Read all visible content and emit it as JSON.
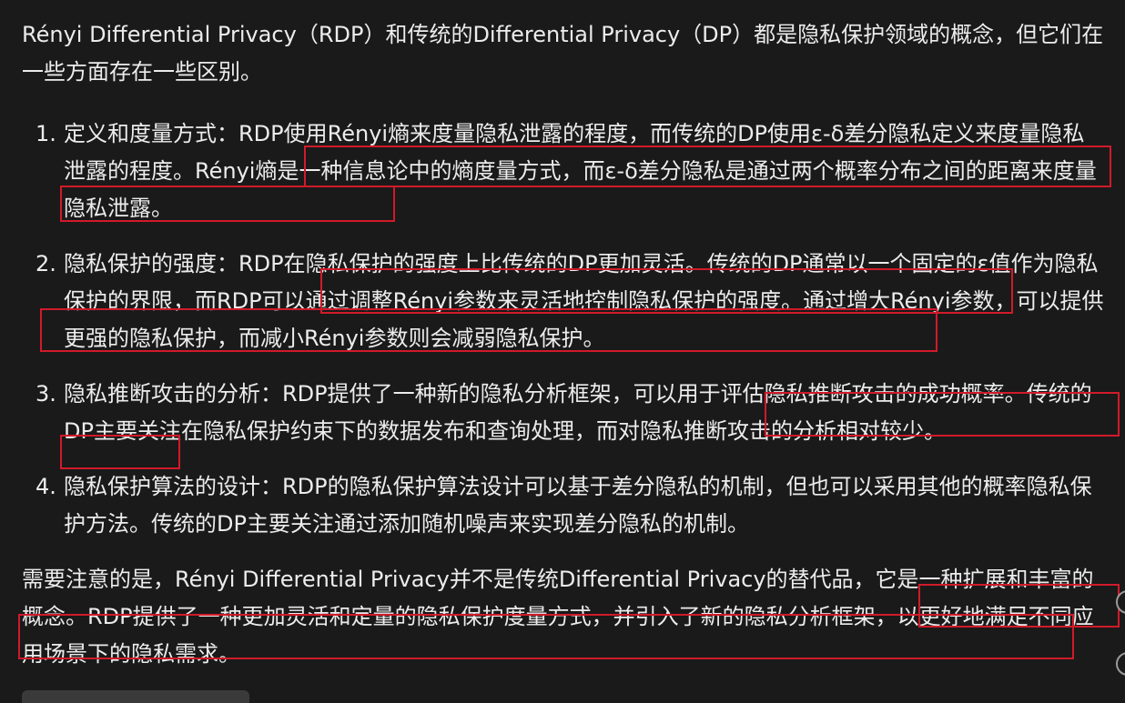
{
  "intro": "Rényi Differential Privacy（RDP）和传统的Differential Privacy（DP）都是隐私保护领域的概念，但它们在一些方面存在一些区别。",
  "items": [
    {
      "number": "1.",
      "text": "定义和度量方式：RDP使用Rényi熵来度量隐私泄露的程度，而传统的DP使用ε-δ差分隐私定义来度量隐私泄露的程度。Rényi熵是一种信息论中的熵度量方式，而ε-δ差分隐私是通过两个概率分布之间的距离来度量隐私泄露。"
    },
    {
      "number": "2.",
      "text": "隐私保护的强度：RDP在隐私保护的强度上比传统的DP更加灵活。传统的DP通常以一个固定的ε值作为隐私保护的界限，而RDP可以通过调整Rényi参数来灵活地控制隐私保护的强度。通过增大Rényi参数，可以提供更强的隐私保护，而减小Rényi参数则会减弱隐私保护。"
    },
    {
      "number": "3.",
      "text": "隐私推断攻击的分析：RDP提供了一种新的隐私分析框架，可以用于评估隐私推断攻击的成功概率。传统的DP主要关注在隐私保护约束下的数据发布和查询处理，而对隐私推断攻击的分析相对较少。"
    },
    {
      "number": "4.",
      "text": "隐私保护算法的设计：RDP的隐私保护算法设计可以基于差分隐私的机制，但也可以采用其他的概率隐私保护方法。传统的DP主要关注通过添加随机噪声来实现差分隐私的机制。"
    }
  ],
  "outro": "需要注意的是，Rényi Differential Privacy并不是传统Differential Privacy的替代品，它是一种扩展和丰富的概念。RDP提供了一种更加灵活和定量的隐私保护度量方式，并引入了新的隐私分析框架，以更好地满足不同应用场景下的隐私需求。",
  "colors": {
    "background": "#1a1a1a",
    "text": "#ececec",
    "annotation": "#d11a2a"
  }
}
